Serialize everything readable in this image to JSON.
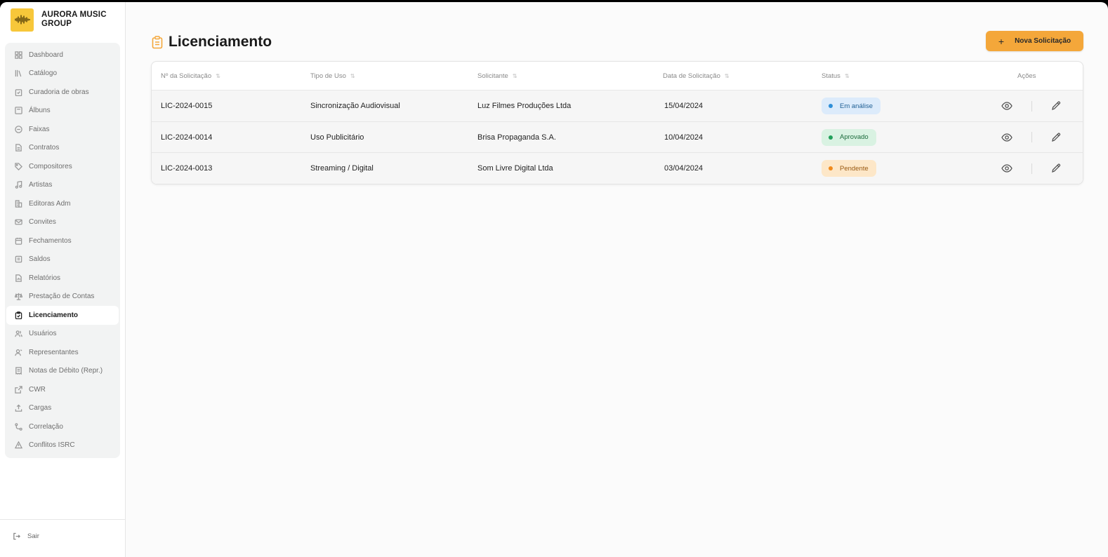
{
  "brand": {
    "name": "AURORA MUSIC GROUP",
    "logo_icon": "soundwave-icon"
  },
  "sidebar": {
    "items": [
      {
        "label": "Dashboard",
        "icon": "grid-icon"
      },
      {
        "label": "Catálogo",
        "icon": "library-icon"
      },
      {
        "label": "Curadoria de obras",
        "icon": "clipboard-check-icon"
      },
      {
        "label": "Álbuns",
        "icon": "album-icon"
      },
      {
        "label": "Faixas",
        "icon": "disc-icon"
      },
      {
        "label": "Contratos",
        "icon": "document-icon"
      },
      {
        "label": "Compositores",
        "icon": "tag-icon"
      },
      {
        "label": "Artistas",
        "icon": "music-note-icon"
      },
      {
        "label": "Editoras Adm",
        "icon": "building-icon"
      },
      {
        "label": "Convites",
        "icon": "mail-icon"
      },
      {
        "label": "Fechamentos",
        "icon": "calendar-icon"
      },
      {
        "label": "Saldos",
        "icon": "wallet-icon"
      },
      {
        "label": "Relatórios",
        "icon": "report-icon"
      },
      {
        "label": "Prestação de Contas",
        "icon": "scale-icon"
      },
      {
        "label": "Licenciamento",
        "icon": "clipboard-icon",
        "active": true
      },
      {
        "label": "Usuários",
        "icon": "users-icon"
      },
      {
        "label": "Representantes",
        "icon": "user-tie-icon"
      },
      {
        "label": "Notas de Débito (Repr.)",
        "icon": "receipt-icon"
      },
      {
        "label": "CWR",
        "icon": "export-icon"
      },
      {
        "label": "Cargas",
        "icon": "upload-icon"
      },
      {
        "label": "Correlação",
        "icon": "link-icon"
      },
      {
        "label": "Conflitos ISRC",
        "icon": "warning-icon"
      }
    ],
    "logout_label": "Sair"
  },
  "page": {
    "title": "Licenciamento",
    "title_icon": "clipboard-icon",
    "new_button": {
      "plus": "+",
      "label": "Nova Solicitação"
    }
  },
  "table": {
    "columns": [
      "Nº da Solicitação",
      "Tipo de Uso",
      "Solicitante",
      "Data de Solicitação",
      "Status",
      "Ações"
    ],
    "sort_glyph": "⇅",
    "rows": [
      {
        "id": "LIC-2024-0015",
        "type": "Sincronização Audiovisual",
        "requester": "Luz Filmes Produções Ltda",
        "date": "15/04/2024",
        "status": "Em análise",
        "status_color": "#2f8fd8",
        "status_bg": "#dcebfb",
        "status_text_color": "#1f5f94"
      },
      {
        "id": "LIC-2024-0014",
        "type": "Uso Publicitário",
        "requester": "Brisa Propaganda S.A.",
        "date": "10/04/2024",
        "status": "Aprovado",
        "status_color": "#22a05a",
        "status_bg": "#d9f2e2",
        "status_text_color": "#1c6b3c"
      },
      {
        "id": "LIC-2024-0013",
        "type": "Streaming / Digital",
        "requester": "Som Livre Digital Ltda",
        "date": "03/04/2024",
        "status": "Pendente",
        "status_color": "#f08a1c",
        "status_bg": "#fde7c8",
        "status_text_color": "#9a5a12"
      }
    ]
  },
  "colors": {
    "accent": "#f4a73a",
    "brand_logo": "#f7c73a"
  }
}
